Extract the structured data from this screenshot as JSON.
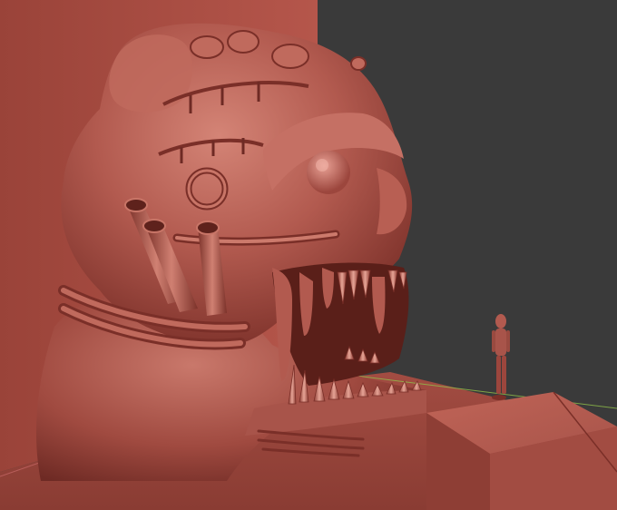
{
  "scene": {
    "description_visible_text": "",
    "colors": {
      "background": "#3a3a3a",
      "clay_base": "#b0574d",
      "clay_light": "#d98a7c",
      "clay_dark": "#6e2a24",
      "clay_mid": "#a04a40",
      "wall": "#a84c42",
      "floor": "#9c463d",
      "axis_green": "#8fbf4a",
      "axis_red": "#c0504d"
    },
    "icons": [
      "skull-sculpt",
      "tube-icon",
      "figure-icon"
    ]
  }
}
